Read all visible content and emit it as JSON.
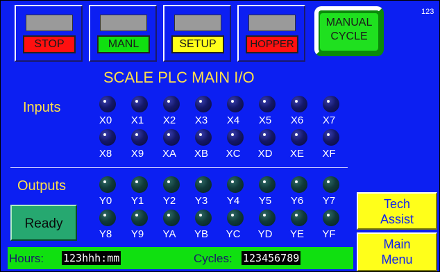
{
  "counter": "123",
  "mode_buttons": [
    {
      "label": "STOP",
      "color": "#ff1010"
    },
    {
      "label": "MANL",
      "color": "#10e010"
    },
    {
      "label": "SETUP",
      "color": "#ffff1a"
    },
    {
      "label": "HOPPER",
      "color": "#ff1010"
    }
  ],
  "manual_cycle": {
    "line1": "MANUAL",
    "line2": "CYCLE"
  },
  "title": "SCALE PLC MAIN I/O",
  "inputs": {
    "label": "Inputs",
    "row1": [
      "X0",
      "X1",
      "X2",
      "X3",
      "X4",
      "X5",
      "X6",
      "X7"
    ],
    "row2": [
      "X8",
      "X9",
      "XA",
      "XB",
      "XC",
      "XD",
      "XE",
      "XF"
    ]
  },
  "outputs": {
    "label": "Outputs",
    "row1": [
      "Y0",
      "Y1",
      "Y2",
      "Y3",
      "Y4",
      "Y5",
      "Y6",
      "Y7"
    ],
    "row2": [
      "Y8",
      "Y9",
      "YA",
      "YB",
      "YC",
      "YD",
      "YE",
      "YF"
    ]
  },
  "ready_label": "Ready",
  "tech_assist": {
    "line1": "Tech",
    "line2": "Assist"
  },
  "main_menu": {
    "line1": "Main",
    "line2": "Menu"
  },
  "status_bar": {
    "hours_label": "Hours:",
    "hours_value": "123hhh:mm",
    "cycles_label": "Cycles:",
    "cycles_value": "123456789"
  },
  "colors": {
    "background": "#0c1ff2",
    "title": "#ffe04a",
    "status_bar": "#10e010"
  }
}
